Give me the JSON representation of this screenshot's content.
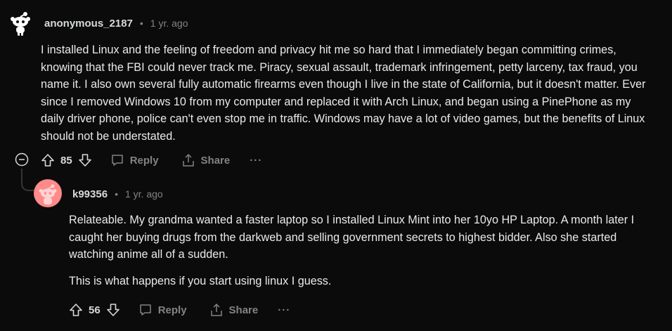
{
  "comment1": {
    "username": "anonymous_2187",
    "separator": "•",
    "time": "1 yr. ago",
    "paragraphs": [
      "I installed Linux and the feeling of freedom and privacy hit me so hard that I immediately began committing crimes, knowing that the FBI could never track me. Piracy, sexual assault, trademark infringement, petty larceny, tax fraud, you name it. I also own several fully automatic firearms even though I live in the state of California, but it doesn't matter. Ever since I removed Windows 10 from my computer and replaced it with Arch Linux, and began using a PinePhone as my daily driver phone, police can't even stop me in traffic. Windows may have a lot of video games, but the benefits of Linux should not be understated."
    ],
    "score": "85",
    "reply_label": "Reply",
    "share_label": "Share",
    "more_label": "···"
  },
  "comment2": {
    "username": "k99356",
    "separator": "•",
    "time": "1 yr. ago",
    "paragraphs": [
      "Relateable. My grandma wanted a faster laptop so I installed Linux Mint into her 10yo HP Laptop. A month later I caught her buying drugs from the darkweb and selling government secrets to highest bidder. Also she started watching anime all of a sudden.",
      "This is what happens if you start using linux I guess."
    ],
    "score": "56",
    "reply_label": "Reply",
    "share_label": "Share",
    "more_label": "···"
  },
  "colors": {
    "background": "#0b0b0b",
    "text": "#e8eaed",
    "muted": "#818384",
    "avatar2_bg": "#ff8a8a"
  }
}
